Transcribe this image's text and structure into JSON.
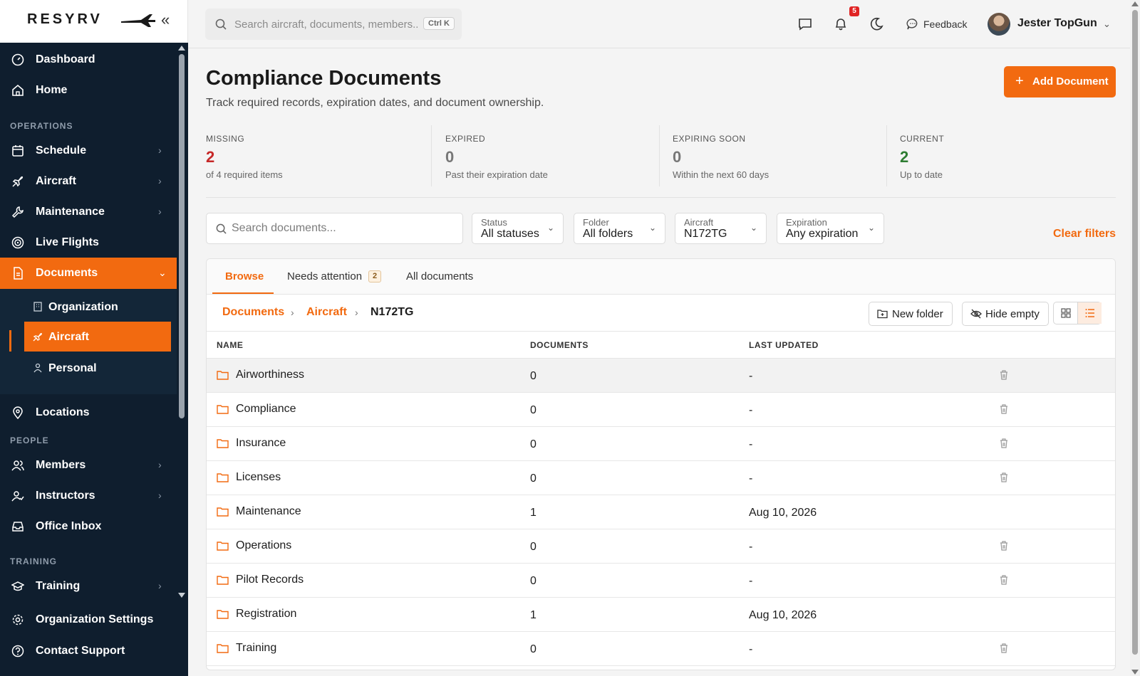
{
  "brand": {
    "logo_text": "RESYRV"
  },
  "sidebar": {
    "top_items": [
      {
        "label": "Dashboard",
        "icon": "gauge-icon"
      },
      {
        "label": "Home",
        "icon": "home-icon"
      }
    ],
    "sections": {
      "operations": "OPERATIONS",
      "people": "PEOPLE",
      "training": "TRAINING"
    },
    "operations_items": [
      {
        "label": "Schedule",
        "icon": "calendar-icon"
      },
      {
        "label": "Aircraft",
        "icon": "plane-icon"
      },
      {
        "label": "Maintenance",
        "icon": "wrench-icon"
      },
      {
        "label": "Live Flights",
        "icon": "radar-icon"
      },
      {
        "label": "Documents",
        "icon": "document-icon"
      }
    ],
    "documents_sub": [
      {
        "label": "Organization",
        "icon": "building-icon"
      },
      {
        "label": "Aircraft",
        "icon": "plane-icon"
      },
      {
        "label": "Personal",
        "icon": "user-icon"
      }
    ],
    "locations": "Locations",
    "people_items": [
      {
        "label": "Members",
        "icon": "users-icon"
      },
      {
        "label": "Instructors",
        "icon": "instructor-icon"
      },
      {
        "label": "Office Inbox",
        "icon": "inbox-icon"
      }
    ],
    "training_items": [
      {
        "label": "Training",
        "icon": "graduation-cap-icon"
      }
    ],
    "bottom_items": [
      {
        "label": "Organization Settings",
        "icon": "gear-icon"
      },
      {
        "label": "Contact Support",
        "icon": "help-circle-icon"
      }
    ]
  },
  "header": {
    "search_placeholder": "Search aircraft, documents, members...",
    "search_shortcut": "Ctrl K",
    "notifications_count": "5",
    "feedback_label": "Feedback",
    "user_name": "Jester TopGun"
  },
  "page": {
    "title": "Compliance Documents",
    "subtitle": "Track required records, expiration dates, and document ownership.",
    "add_button": "Add Document"
  },
  "stats": [
    {
      "key": "MISSING",
      "value": "2",
      "desc": "of 4 required items",
      "color": "#c62828"
    },
    {
      "key": "EXPIRED",
      "value": "0",
      "desc": "Past their expiration date",
      "color": "#777777"
    },
    {
      "key": "EXPIRING SOON",
      "value": "0",
      "desc": "Within the next 60 days",
      "color": "#777777"
    },
    {
      "key": "CURRENT",
      "value": "2",
      "desc": "Up to date",
      "color": "#2e7d32"
    }
  ],
  "filters": {
    "search_placeholder": "Search documents...",
    "status": {
      "label": "Status",
      "value": "All statuses"
    },
    "folder": {
      "label": "Folder",
      "value": "All folders"
    },
    "aircraft": {
      "label": "Aircraft",
      "value": "N172TG"
    },
    "expiration": {
      "label": "Expiration",
      "value": "Any expiration"
    },
    "clear": "Clear filters"
  },
  "tabs": {
    "browse": "Browse",
    "needs_attention": "Needs attention",
    "needs_attention_count": "2",
    "all_documents": "All documents"
  },
  "breadcrumb": {
    "root": "Documents",
    "mid": "Aircraft",
    "current": "N172TG"
  },
  "toolbar": {
    "new_folder": "New folder",
    "hide_empty": "Hide empty"
  },
  "table": {
    "columns": {
      "name": "NAME",
      "documents": "DOCUMENTS",
      "updated": "LAST UPDATED"
    },
    "rows": [
      {
        "name": "Airworthiness",
        "documents": "0",
        "updated": "-"
      },
      {
        "name": "Compliance",
        "documents": "0",
        "updated": "-"
      },
      {
        "name": "Insurance",
        "documents": "0",
        "updated": "-"
      },
      {
        "name": "Licenses",
        "documents": "0",
        "updated": "-"
      },
      {
        "name": "Maintenance",
        "documents": "1",
        "updated": "Aug 10, 2026"
      },
      {
        "name": "Operations",
        "documents": "0",
        "updated": "-"
      },
      {
        "name": "Pilot Records",
        "documents": "0",
        "updated": "-"
      },
      {
        "name": "Registration",
        "documents": "1",
        "updated": "Aug 10, 2026"
      },
      {
        "name": "Training",
        "documents": "0",
        "updated": "-"
      }
    ]
  },
  "colors": {
    "accent": "#f26a10",
    "sidebar": "#0f1e2e"
  }
}
